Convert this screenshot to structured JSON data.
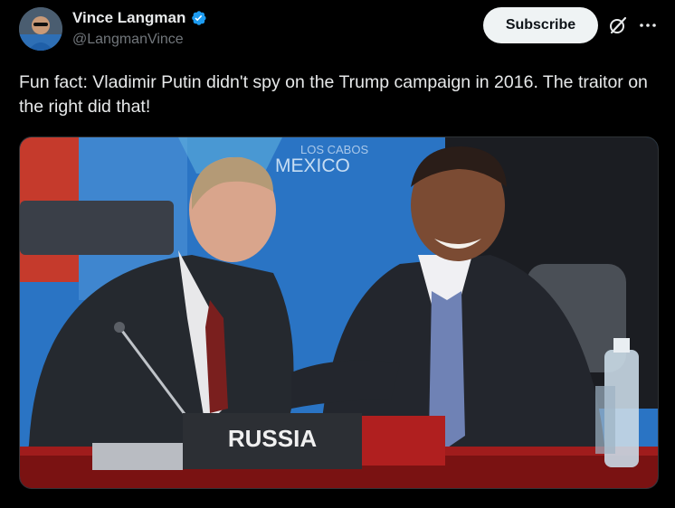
{
  "tweet": {
    "author": {
      "display_name": "Vince Langman",
      "handle": "@LangmanVince",
      "verified_icon": "verified-badge-icon"
    },
    "subscribe_label": "Subscribe",
    "text": "Fun fact: Vladimir Putin didn't spy on the Trump campaign in 2016. The traitor on the right did that!",
    "media": {
      "sign_text": "RUSSIA",
      "backdrop_text_top": "LOS CABOS",
      "backdrop_text_bottom": "MEXICO"
    }
  },
  "icons": {
    "grok": "grok-icon",
    "more": "more-icon"
  },
  "colors": {
    "background": "#000000",
    "text_primary": "#e7e9ea",
    "text_secondary": "#71767b",
    "verified": "#1d9bf0",
    "subscribe_bg": "#eff3f4"
  }
}
